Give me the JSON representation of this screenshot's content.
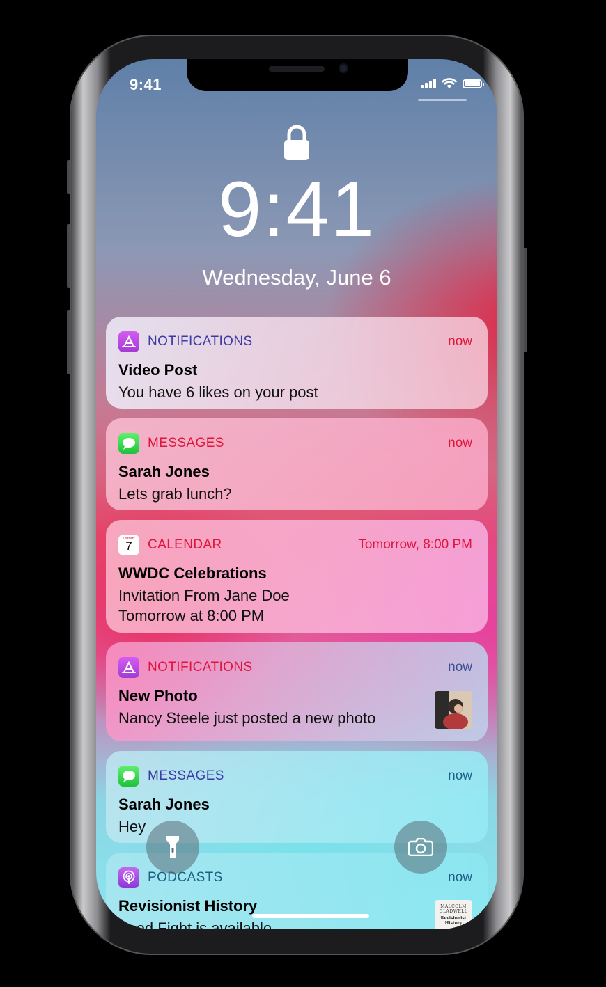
{
  "status_bar": {
    "time": "9:41",
    "signal_icon": "cellular-signal-icon",
    "wifi_icon": "wifi-icon",
    "battery_icon": "battery-icon"
  },
  "lock_screen": {
    "lock_icon": "lock-icon",
    "time": "9:41",
    "date": "Wednesday, June 6"
  },
  "notifications": [
    {
      "app": "NOTIFICATIONS",
      "icon": "app-store-icon",
      "time": "now",
      "title": "Video Post",
      "body": [
        "You have 6 likes on your post"
      ]
    },
    {
      "app": "MESSAGES",
      "icon": "messages-icon",
      "time": "now",
      "title": "Sarah Jones",
      "body": [
        "Lets grab lunch?"
      ]
    },
    {
      "app": "CALENDAR",
      "icon": "calendar-icon",
      "icon_day_label": "Thursday",
      "icon_day_number": "7",
      "time": "Tomorrow, 8:00 PM",
      "title": "WWDC Celebrations",
      "body": [
        "Invitation From Jane Doe",
        "Tomorrow at 8:00 PM"
      ]
    },
    {
      "app": "NOTIFICATIONS",
      "icon": "app-store-icon",
      "time": "now",
      "title": "New Photo",
      "body": [
        "Nancy Steele just posted a new photo"
      ],
      "thumbnail": "photo-thumbnail"
    },
    {
      "app": "MESSAGES",
      "icon": "messages-icon",
      "time": "now",
      "title": "Sarah Jones",
      "body": [
        "Hey"
      ]
    },
    {
      "app": "PODCASTS",
      "icon": "podcasts-icon",
      "time": "now",
      "title": "Revisionist History",
      "body": [
        "Food Fight is available"
      ],
      "thumbnail": "podcast-artwork",
      "artwork_lines": [
        "MALCOLM",
        "GLADWELL",
        "Revisionist",
        "History"
      ]
    }
  ],
  "quick_actions": {
    "flashlight_icon": "flashlight-icon",
    "camera_icon": "camera-icon"
  },
  "colors": {
    "accent_purple": "#3d3aa6",
    "accent_red": "#e0143c",
    "accent_teal": "#1f5f86",
    "app_store": "#c944e6",
    "messages": "#2bd94a",
    "podcasts": "#a84ae0"
  }
}
